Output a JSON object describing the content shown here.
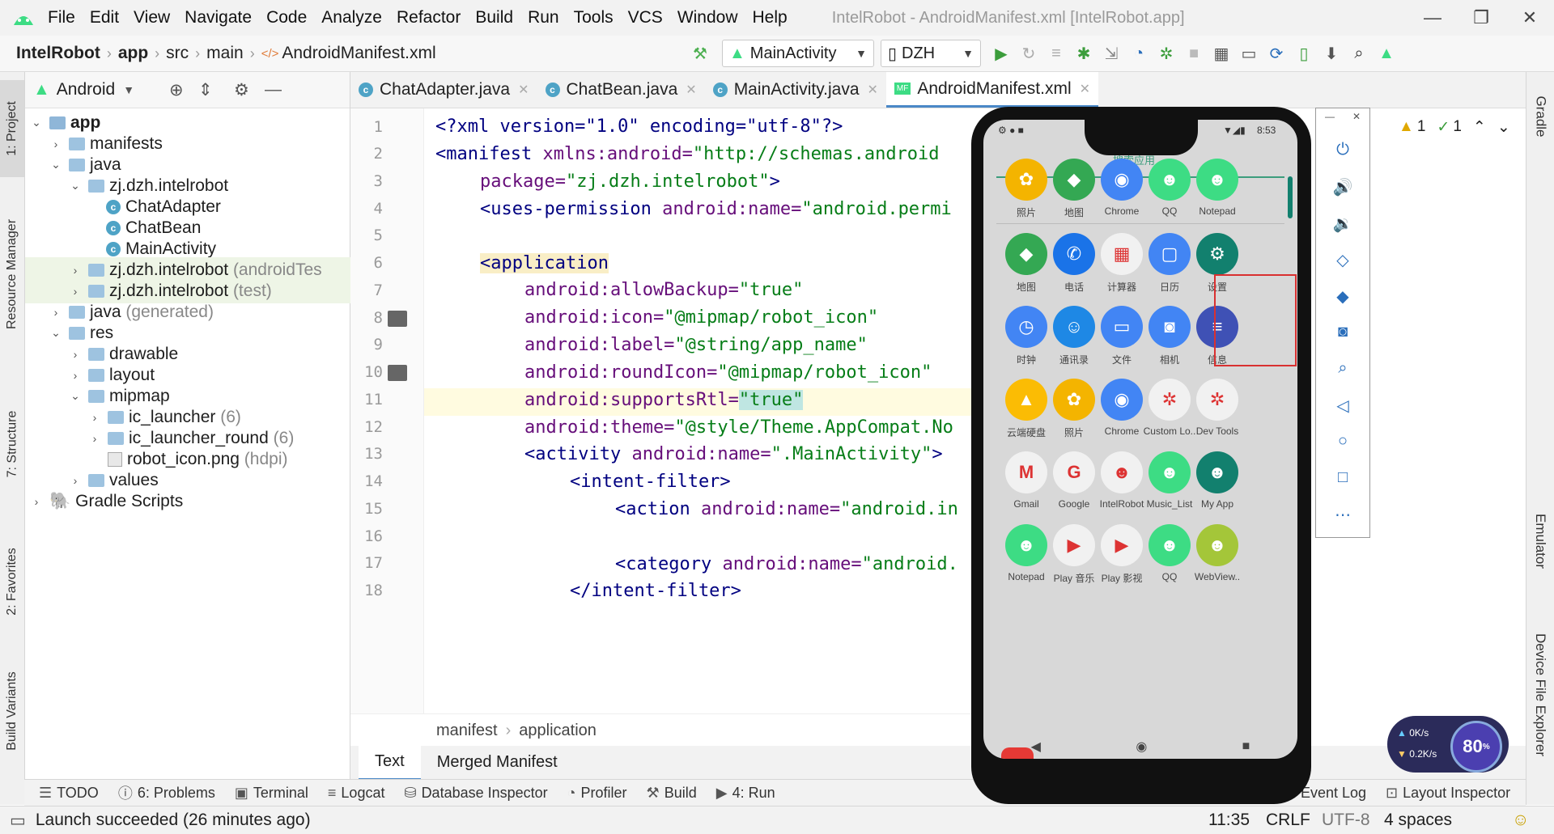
{
  "menu": [
    "File",
    "Edit",
    "View",
    "Navigate",
    "Code",
    "Analyze",
    "Refactor",
    "Build",
    "Run",
    "Tools",
    "VCS",
    "Window",
    "Help"
  ],
  "window_title": "IntelRobot - AndroidManifest.xml [IntelRobot.app]",
  "breadcrumb": [
    "IntelRobot",
    "app",
    "src",
    "main",
    "AndroidManifest.xml"
  ],
  "run_config": "MainActivity",
  "device": "DZH",
  "left_tabs": [
    "1: Project",
    "Resource Manager",
    "7: Structure",
    "2: Favorites",
    "Build Variants"
  ],
  "right_tabs": [
    "Gradle",
    "Emulator",
    "Device File Explorer"
  ],
  "project_view": "Android",
  "tree": [
    {
      "label": "app",
      "extra": ""
    },
    {
      "label": "manifests",
      "extra": ""
    },
    {
      "label": "java",
      "extra": ""
    },
    {
      "label": "zj.dzh.intelrobot",
      "extra": ""
    },
    {
      "label": "ChatAdapter",
      "extra": ""
    },
    {
      "label": "ChatBean",
      "extra": ""
    },
    {
      "label": "MainActivity",
      "extra": ""
    },
    {
      "label": "zj.dzh.intelrobot",
      "extra": "(androidTes"
    },
    {
      "label": "zj.dzh.intelrobot",
      "extra": "(test)"
    },
    {
      "label": "java",
      "extra": "(generated)"
    },
    {
      "label": "res",
      "extra": ""
    },
    {
      "label": "drawable",
      "extra": ""
    },
    {
      "label": "layout",
      "extra": ""
    },
    {
      "label": "mipmap",
      "extra": ""
    },
    {
      "label": "ic_launcher",
      "extra": "(6)"
    },
    {
      "label": "ic_launcher_round",
      "extra": "(6)"
    },
    {
      "label": "robot_icon.png",
      "extra": "(hdpi)"
    },
    {
      "label": "values",
      "extra": ""
    },
    {
      "label": "Gradle Scripts",
      "extra": ""
    }
  ],
  "tabs": [
    "ChatAdapter.java",
    "ChatBean.java",
    "MainActivity.java",
    "AndroidManifest.xml"
  ],
  "line_numbers": [
    "1",
    "2",
    "3",
    "4",
    "5",
    "6",
    "7",
    "8",
    "9",
    "10",
    "11",
    "12",
    "13",
    "14",
    "15",
    "16",
    "17",
    "18"
  ],
  "code": {
    "l1": "<?xml version=\"1.0\" encoding=\"utf-8\"?>",
    "l2a": "<manifest",
    "l2b": " xmlns:android=",
    "l2c": "\"http://schemas.android",
    "l3a": "package=",
    "l3b": "\"zj.dzh.intelrobot\"",
    "l3c": ">",
    "l4a": "<uses-permission",
    "l4b": " android:name=",
    "l4c": "\"android.permi",
    "l6": "<application",
    "l7a": "android:allowBackup=",
    "l7b": "\"true\"",
    "l8a": "android:icon=",
    "l8b": "\"@mipmap/robot_icon\"",
    "l9a": "android:label=",
    "l9b": "\"@string/app_name\"",
    "l10a": "android:roundIcon=",
    "l10b": "\"@mipmap/robot_icon\"",
    "l11a": "android:supportsRtl=",
    "l11b": "\"true\"",
    "l12a": "android:theme=",
    "l12b": "\"@style/Theme.AppCompat.No",
    "l13a": "<activity",
    "l13b": " android:name=",
    "l13c": "\".MainActivity\"",
    "l13d": ">",
    "l14": "<intent-filter>",
    "l15a": "<action",
    "l15b": " android:name=",
    "l15c": "\"android.in",
    "l17a": "<category",
    "l17b": " android:name=",
    "l17c": "\"android.",
    "l18": "</intent-filter>"
  },
  "editor_breadcrumb": [
    "manifest",
    "application"
  ],
  "sub_tabs": [
    "Text",
    "Merged Manifest"
  ],
  "bottom_tools": [
    "TODO",
    "6: Problems",
    "Terminal",
    "Logcat",
    "Database Inspector",
    "Profiler",
    "Build",
    "4: Run",
    "Event Log",
    "Layout Inspector"
  ],
  "status": {
    "message": "Launch succeeded (26 minutes ago)",
    "position": "11:35",
    "line_sep": "CRLF",
    "encoding": "UTF-8",
    "indent": "4 spaces"
  },
  "inspections": {
    "warnings": "1",
    "weak": "1"
  },
  "phone": {
    "time": "8:53",
    "search": "搜索应用",
    "apps": [
      [
        "照片",
        "地图",
        "Chrome",
        "QQ",
        "Notepad"
      ],
      [
        "地图",
        "电话",
        "计算器",
        "日历",
        "设置"
      ],
      [
        "时钟",
        "通讯录",
        "文件",
        "相机",
        "信息"
      ],
      [
        "云端硬盘",
        "照片",
        "Chrome",
        "Custom Lo..",
        "Dev Tools"
      ],
      [
        "Gmail",
        "Google",
        "IntelRobot",
        "Music_List",
        "My App"
      ],
      [
        "Notepad",
        "Play 音乐",
        "Play 影视",
        "QQ",
        "WebView.."
      ]
    ]
  },
  "speed": {
    "up": "0K/s",
    "down": "0.2K/s",
    "percent": "80",
    "unit": "%"
  },
  "colors": {
    "accent": "#4a88c7",
    "highlight_box": "#d93030",
    "android_green": "#3ddc84"
  }
}
